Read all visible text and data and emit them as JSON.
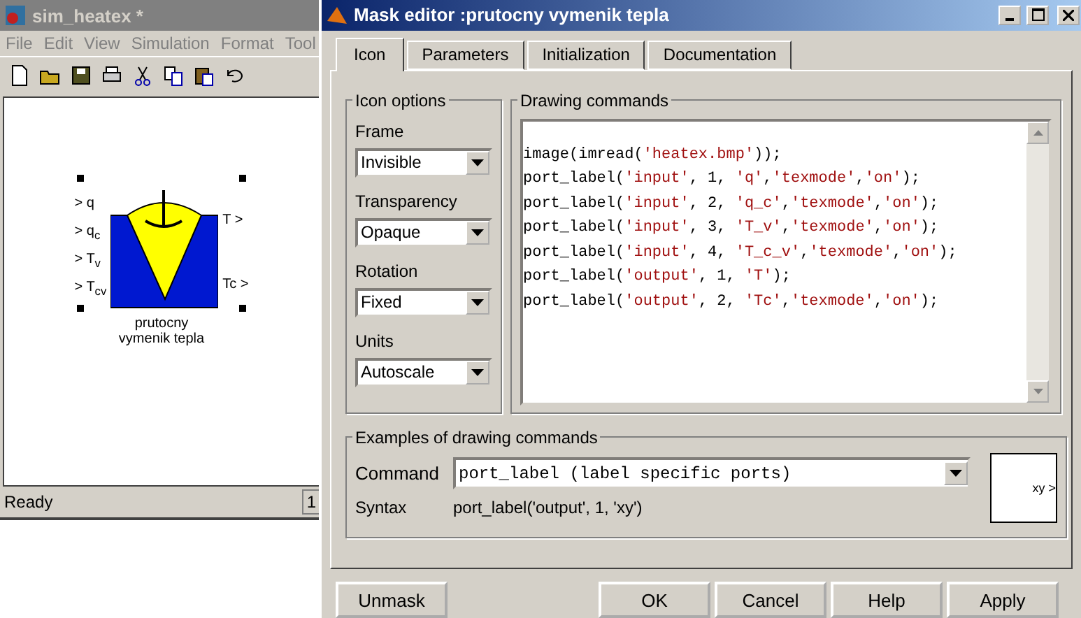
{
  "model_window": {
    "title": "sim_heatex *",
    "menu": [
      "File",
      "Edit",
      "View",
      "Simulation",
      "Format",
      "Tool"
    ],
    "block": {
      "inputs": [
        "> q",
        "> q$_{c}$",
        "> T$_{v}$",
        "> T$_{cv}$"
      ],
      "outputs": [
        "T >",
        "Tc >"
      ],
      "label": "prutocny vymenik tepla",
      "selected": true
    },
    "status": "Ready",
    "status_field": "1"
  },
  "dialog": {
    "title": "Mask editor :prutocny vymenik tepla",
    "tabs": [
      {
        "label": "Icon",
        "selected": true
      },
      {
        "label": "Parameters",
        "selected": false
      },
      {
        "label": "Initialization",
        "selected": false
      },
      {
        "label": "Documentation",
        "selected": false
      }
    ],
    "icon_options": {
      "title": "Icon options",
      "fields": [
        {
          "label": "Frame",
          "value": "Invisible"
        },
        {
          "label": "Transparency",
          "value": "Opaque"
        },
        {
          "label": "Rotation",
          "value": "Fixed"
        },
        {
          "label": "Units",
          "value": "Autoscale"
        }
      ]
    },
    "drawing_commands": {
      "title": "Drawing commands",
      "lines": [
        "image(imread('heatex.bmp'));",
        "port_label('input', 1, 'q','texmode','on');",
        "port_label('input', 2, 'q_c','texmode','on');",
        "port_label('input', 3, 'T_v','texmode','on');",
        "port_label('input', 4, 'T_c_v','texmode','on');",
        "port_label('output', 1, 'T');",
        "port_label('output', 2, 'Tc','texmode','on');"
      ]
    },
    "examples": {
      "title": "Examples of drawing commands",
      "command_label": "Command",
      "command": "port_label (label specific ports)",
      "syntax_label": "Syntax",
      "syntax": "port_label('output', 1, 'xy')",
      "preview_label": "xy >"
    },
    "buttons": [
      "Unmask",
      "OK",
      "Cancel",
      "Help",
      "Apply"
    ]
  }
}
